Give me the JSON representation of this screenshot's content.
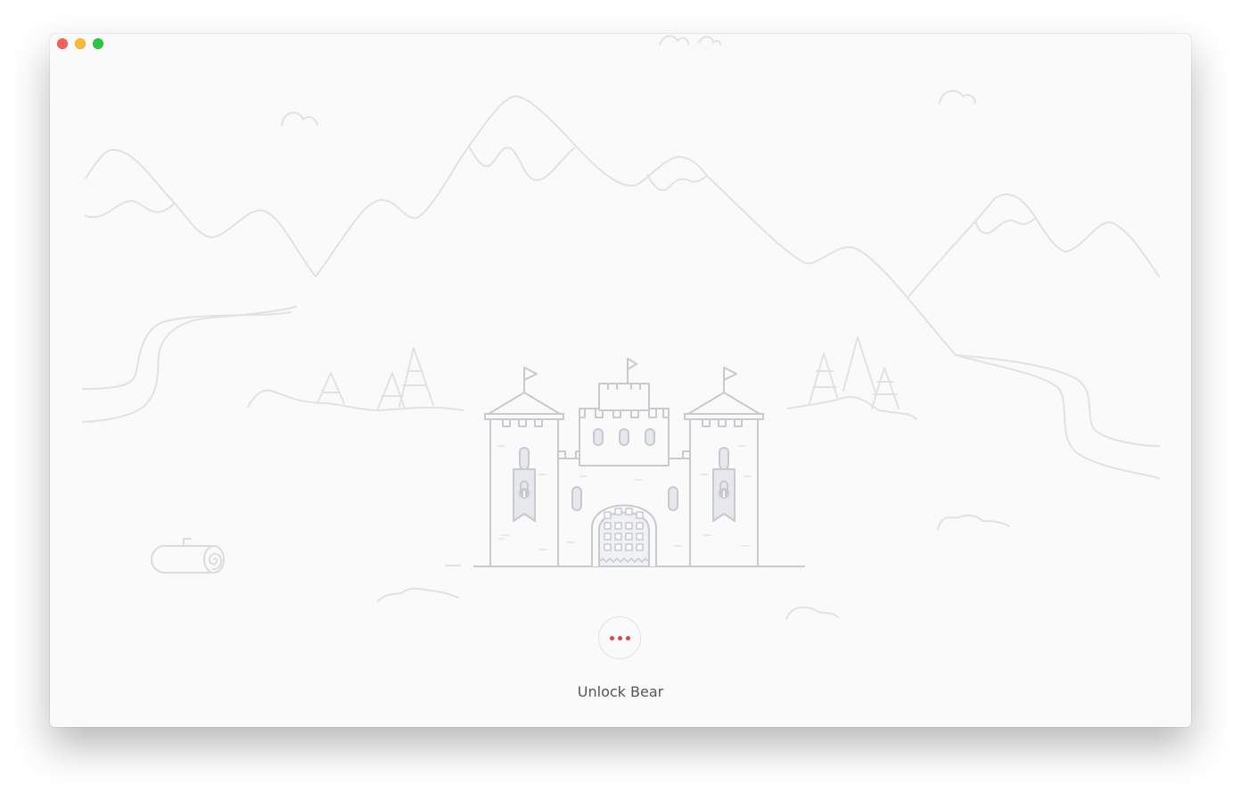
{
  "window": {
    "controls": {
      "close": {
        "icon": "close-dot-icon",
        "color": "#fc5f57"
      },
      "minimize": {
        "icon": "minimize-dot-icon",
        "color": "#fdbc2e"
      },
      "maximize": {
        "icon": "maximize-dot-icon",
        "color": "#28c840"
      }
    }
  },
  "illustration": {
    "icon": "locked-castle-illustration",
    "line_color": "#e1e1e1",
    "castle_color": "#c7cacf"
  },
  "unlock": {
    "button_icon": "ellipsis-icon",
    "dot_color": "#e0474c",
    "label": "Unlock Bear"
  }
}
